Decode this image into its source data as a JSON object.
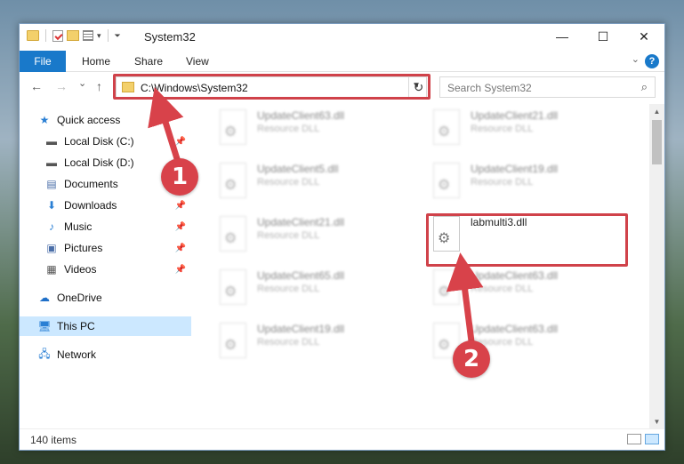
{
  "window": {
    "title": "System32",
    "controls": {
      "minimize": "—",
      "maximize": "☐",
      "close": "✕"
    }
  },
  "ribbon": {
    "tabs": [
      "File",
      "Home",
      "Share",
      "View"
    ],
    "help": "?"
  },
  "nav": {
    "back": "←",
    "forward": "→",
    "recent": "⌄",
    "up": "↑",
    "address": "C:\\Windows\\System32",
    "refresh": "↻",
    "search_placeholder": "Search System32",
    "search_icon": "search-icon"
  },
  "sidebar": {
    "items": [
      {
        "label": "Quick access",
        "icon": "star-icon",
        "pinned": false
      },
      {
        "label": "Local Disk (C:)",
        "icon": "drive-icon",
        "pinned": true
      },
      {
        "label": "Local Disk (D:)",
        "icon": "drive-icon",
        "pinned": false
      },
      {
        "label": "Documents",
        "icon": "documents-icon",
        "pinned": false
      },
      {
        "label": "Downloads",
        "icon": "download-icon",
        "pinned": true
      },
      {
        "label": "Music",
        "icon": "music-icon",
        "pinned": true
      },
      {
        "label": "Pictures",
        "icon": "pictures-icon",
        "pinned": true
      },
      {
        "label": "Videos",
        "icon": "videos-icon",
        "pinned": true
      },
      {
        "label": "OneDrive",
        "icon": "cloud-icon",
        "pinned": false
      },
      {
        "label": "This PC",
        "icon": "pc-icon",
        "pinned": false,
        "selected": true
      },
      {
        "label": "Network",
        "icon": "network-icon",
        "pinned": false
      }
    ]
  },
  "files": [
    {
      "name": "UpdateClient63.dll",
      "type": "Resource DLL",
      "blurred": true
    },
    {
      "name": "UpdateClient21.dll",
      "type": "Resource DLL",
      "blurred": true
    },
    {
      "name": "UpdateClient5.dll",
      "type": "Resource DLL",
      "blurred": true
    },
    {
      "name": "UpdateClient19.dll",
      "type": "Resource DLL",
      "blurred": true
    },
    {
      "name": "UpdateClient21.dll",
      "type": "Resource DLL",
      "blurred": true
    },
    {
      "name": "labmulti3.dll",
      "type": "",
      "blurred": false
    },
    {
      "name": "UpdateClient65.dll",
      "type": "Resource DLL",
      "blurred": true
    },
    {
      "name": "UpdateClient63.dll",
      "type": "Resource DLL",
      "blurred": true
    },
    {
      "name": "UpdateClient19.dll",
      "type": "Resource DLL",
      "blurred": true
    },
    {
      "name": "UpdateClient63.dll",
      "type": "Resource DLL",
      "blurred": true
    }
  ],
  "status": {
    "count": "140 items"
  },
  "annotations": {
    "badge1": "1",
    "badge2": "2",
    "color": "#d8424a"
  }
}
